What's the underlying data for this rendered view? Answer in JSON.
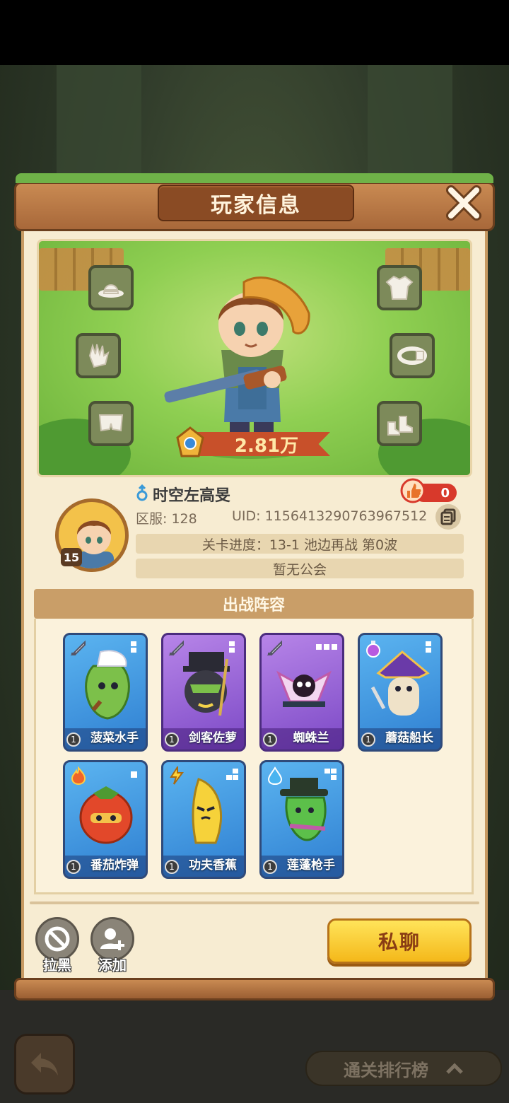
{
  "dialog": {
    "title": "玩家信息"
  },
  "character": {
    "power": "2.81万"
  },
  "player": {
    "name": "时空左高旻",
    "likes": "0",
    "server": "区服: 128",
    "uid": "UID: 1156413290763967512",
    "level": "15",
    "progress": "关卡进度：13-1  池边再战  第0波",
    "guild": "暂无公会"
  },
  "lineup": {
    "title": "出战阵容",
    "cards": [
      {
        "name": "菠菜水手",
        "level": "1",
        "color": "blue",
        "type_icon": "sword-icon"
      },
      {
        "name": "剑客佐萝",
        "level": "1",
        "color": "purple",
        "type_icon": "sword-icon"
      },
      {
        "name": "蜘蛛兰",
        "level": "1",
        "color": "purple",
        "type_icon": "sword-icon"
      },
      {
        "name": "蘑菇船长",
        "level": "1",
        "color": "blue",
        "type_icon": "potion-icon"
      },
      {
        "name": "番茄炸弹",
        "level": "1",
        "color": "blue",
        "type_icon": "fire-icon"
      },
      {
        "name": "功夫香蕉",
        "level": "1",
        "color": "blue",
        "type_icon": "lightning-icon"
      },
      {
        "name": "莲蓬枪手",
        "level": "1",
        "color": "blue",
        "type_icon": "water-drop-icon"
      }
    ]
  },
  "actions": {
    "block_label": "拉黑",
    "add_label": "添加",
    "chat_label": "私聊"
  },
  "background": {
    "rank_label": "通关排行榜"
  }
}
